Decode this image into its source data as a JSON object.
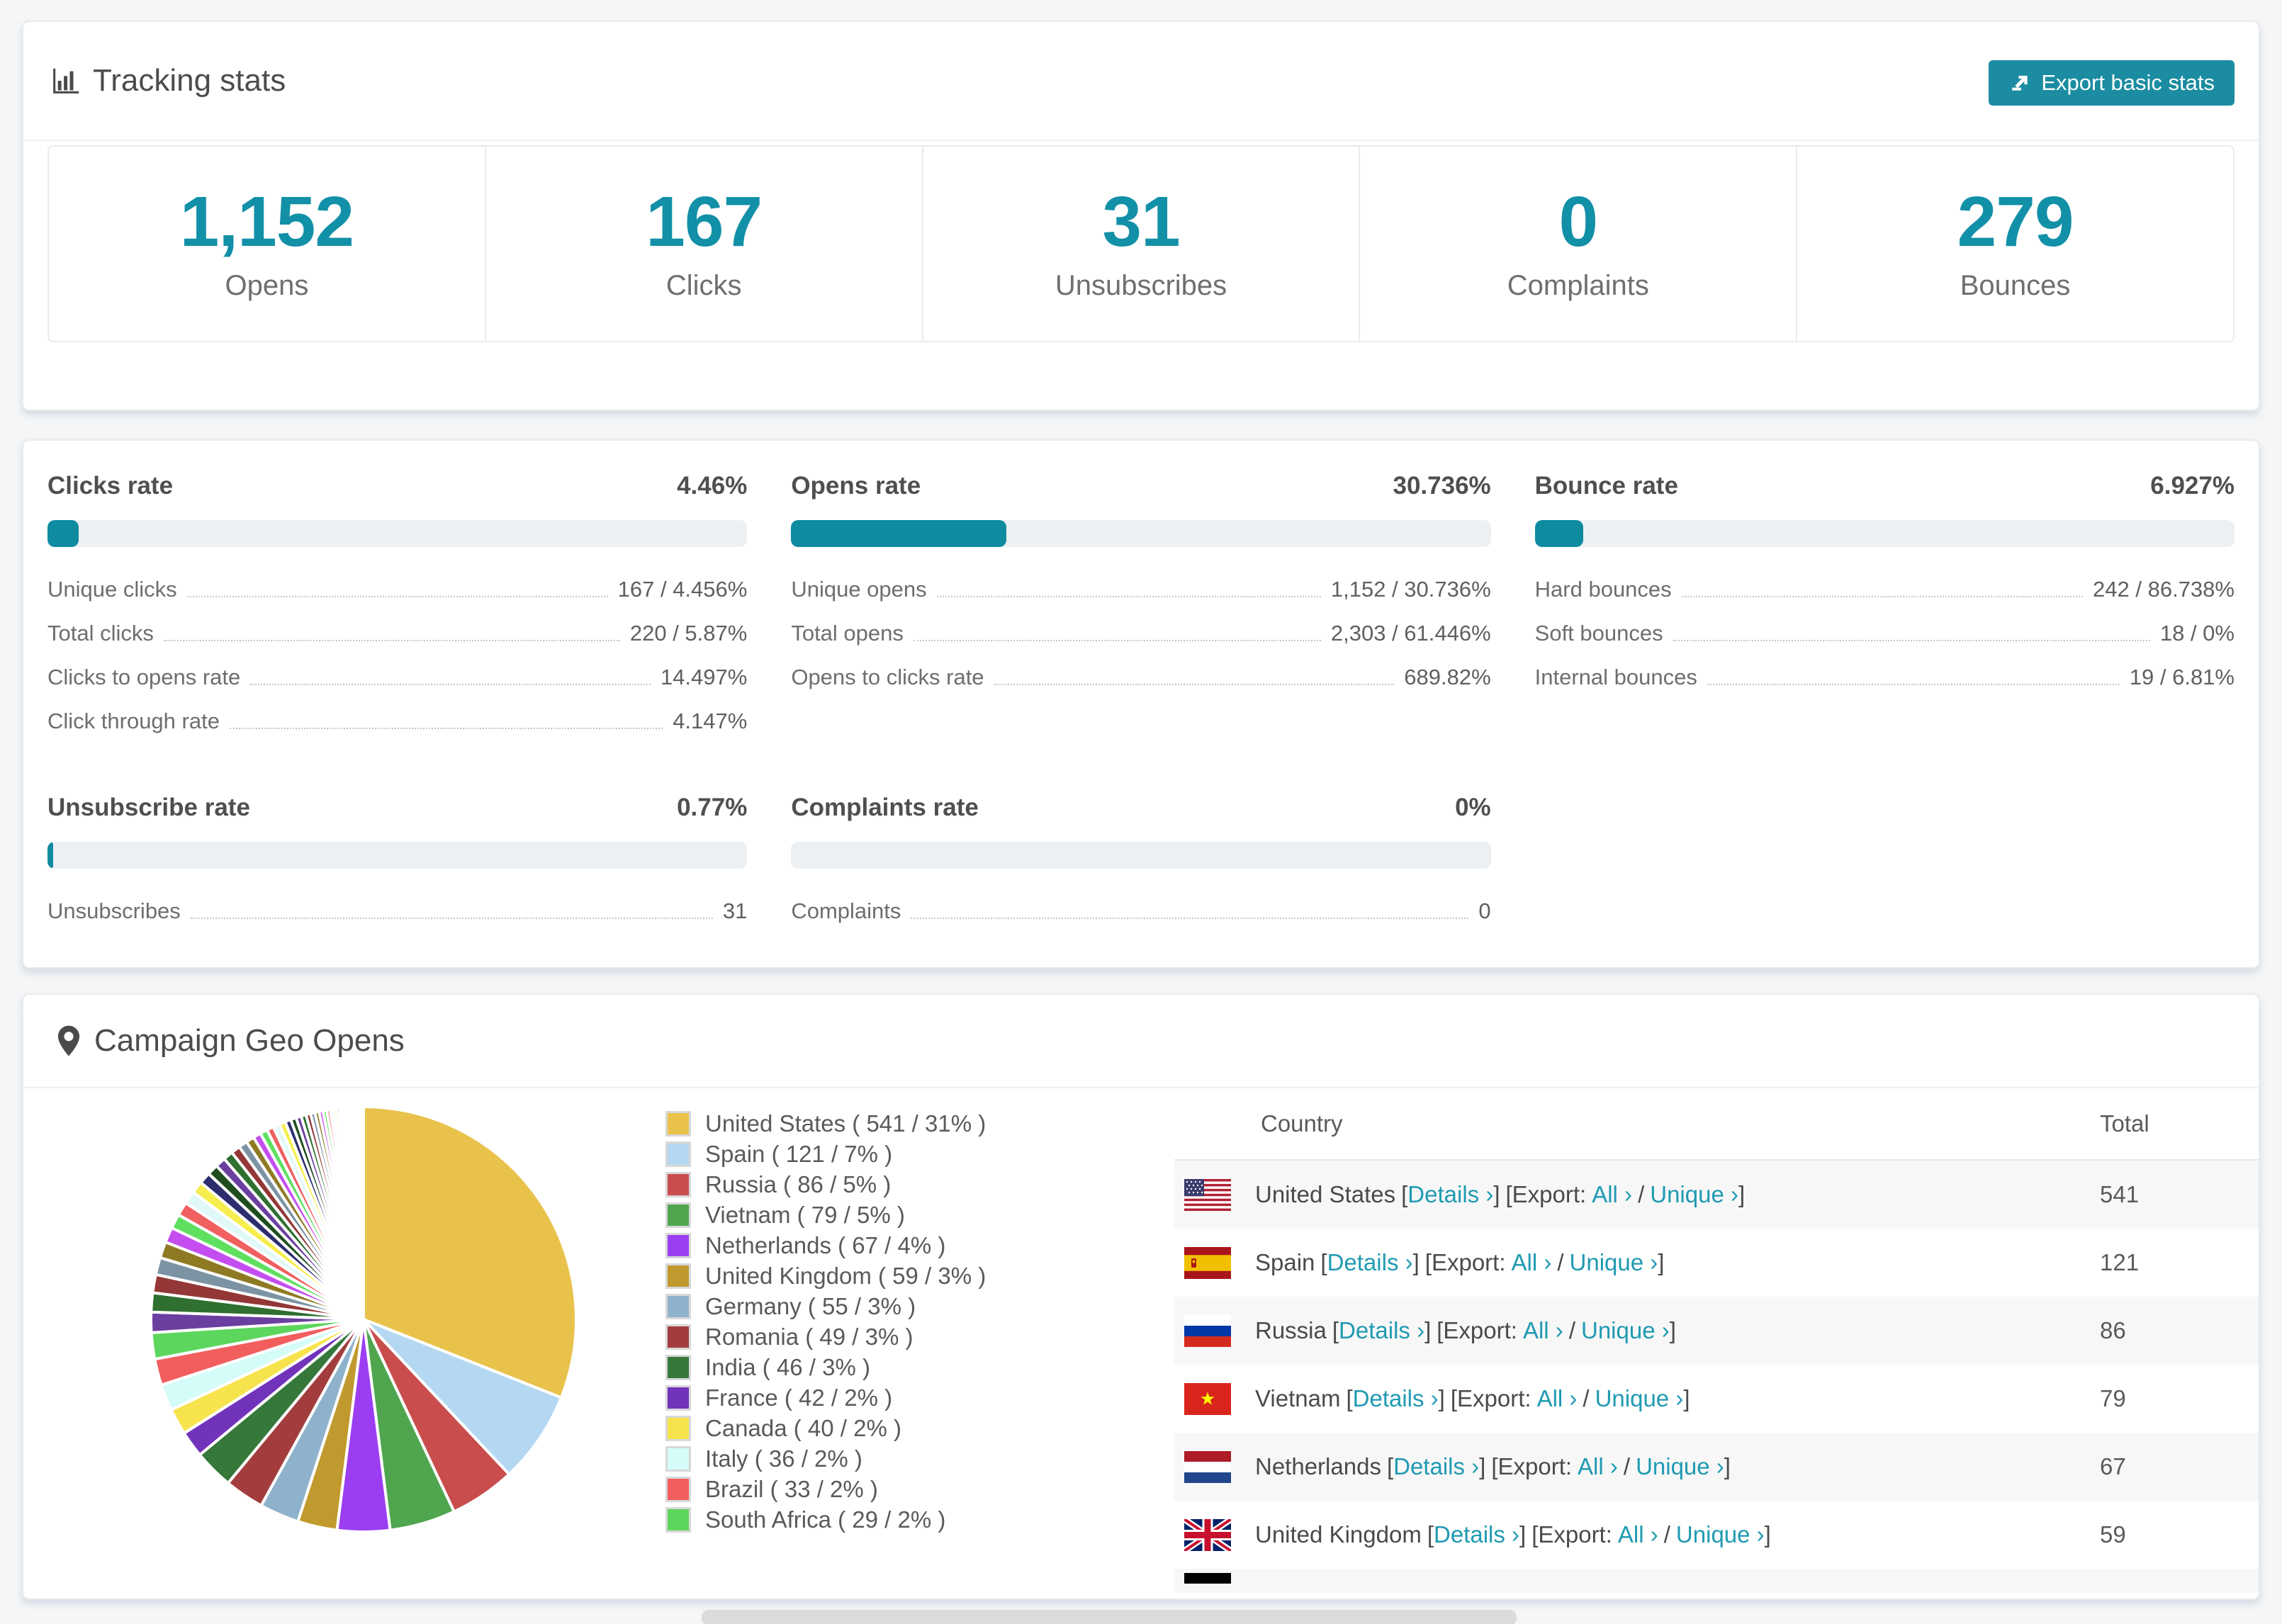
{
  "theme": {
    "accent": "#1290a7",
    "link_color": "#1f9ab2",
    "button_bg": "#1b8ca1",
    "bar_fill": "#0f8ba0",
    "bar_track": "#edf0f2"
  },
  "tracking": {
    "title": "Tracking stats",
    "export_label": "Export basic stats"
  },
  "summary": [
    {
      "value": "1,152",
      "label": "Opens"
    },
    {
      "value": "167",
      "label": "Clicks"
    },
    {
      "value": "31",
      "label": "Unsubscribes"
    },
    {
      "value": "0",
      "label": "Complaints"
    },
    {
      "value": "279",
      "label": "Bounces"
    }
  ],
  "rates": {
    "clicks": {
      "title": "Clicks rate",
      "value": "4.46%",
      "rows": [
        {
          "label": "Unique clicks",
          "value": "167 / 4.456%"
        },
        {
          "label": "Total clicks",
          "value": "220 / 5.87%"
        },
        {
          "label": "Clicks to opens rate",
          "value": "14.497%"
        },
        {
          "label": "Click through rate",
          "value": "4.147%"
        }
      ]
    },
    "opens": {
      "title": "Opens rate",
      "value": "30.736%",
      "rows": [
        {
          "label": "Unique opens",
          "value": "1,152 / 30.736%"
        },
        {
          "label": "Total opens",
          "value": "2,303 / 61.446%"
        },
        {
          "label": "Opens to clicks rate",
          "value": "689.82%"
        }
      ]
    },
    "bounce": {
      "title": "Bounce rate",
      "value": "6.927%",
      "rows": [
        {
          "label": "Hard bounces",
          "value": "242 / 86.738%"
        },
        {
          "label": "Soft bounces",
          "value": "18 / 0%"
        },
        {
          "label": "Internal bounces",
          "value": "19 / 6.81%"
        }
      ]
    },
    "unsubscribe": {
      "title": "Unsubscribe rate",
      "value": "0.77%",
      "rows": [
        {
          "label": "Unsubscribes",
          "value": "31"
        }
      ]
    },
    "complaints": {
      "title": "Complaints rate",
      "value": "0%",
      "rows": [
        {
          "label": "Complaints",
          "value": "0"
        }
      ]
    }
  },
  "geo": {
    "title": "Campaign Geo Opens",
    "legend": [
      {
        "label": "United States ( 541 / 31% )",
        "color": "#e8c24a"
      },
      {
        "label": "Spain ( 121 / 7% )",
        "color": "#b5d8f2"
      },
      {
        "label": "Russia ( 86 / 5% )",
        "color": "#c94d4d"
      },
      {
        "label": "Vietnam ( 79 / 5% )",
        "color": "#4fa64f"
      },
      {
        "label": "Netherlands ( 67 / 4% )",
        "color": "#9b3ef2"
      },
      {
        "label": "United Kingdom ( 59 / 3% )",
        "color": "#c09a2e"
      },
      {
        "label": "Germany ( 55 / 3% )",
        "color": "#8fb2cc"
      },
      {
        "label": "Romania ( 49 / 3% )",
        "color": "#a33d3d"
      },
      {
        "label": "India ( 46 / 3% )",
        "color": "#35783a"
      },
      {
        "label": "France ( 42 / 2% )",
        "color": "#7233bb"
      },
      {
        "label": "Canada ( 40 / 2% )",
        "color": "#f7e34d"
      },
      {
        "label": "Italy ( 36 / 2% )",
        "color": "#d4fcf9"
      },
      {
        "label": "Brazil ( 33 / 2% )",
        "color": "#f25e5e"
      },
      {
        "label": "South Africa ( 29 / 2% )",
        "color": "#5cd65c"
      }
    ],
    "table": {
      "columns": [
        "Country",
        "Total"
      ],
      "link_labels": {
        "open_bracket": "[",
        "close_bracket": "]",
        "details": "Details ›",
        "export_prefix": "[Export:",
        "all": "All ›",
        "slash": "/",
        "unique": "Unique ›"
      },
      "rows": [
        {
          "country": "United States",
          "total": "541",
          "flag": "us"
        },
        {
          "country": "Spain",
          "total": "121",
          "flag": "es"
        },
        {
          "country": "Russia",
          "total": "86",
          "flag": "ru"
        },
        {
          "country": "Vietnam",
          "total": "79",
          "flag": "vn"
        },
        {
          "country": "Netherlands",
          "total": "67",
          "flag": "nl"
        },
        {
          "country": "United Kingdom",
          "total": "59",
          "flag": "gb"
        }
      ],
      "partial_row": {
        "flag": "de"
      }
    }
  },
  "chart_data": {
    "type": "pie",
    "title": "Campaign Geo Opens",
    "unit": "opens",
    "legend_position": "right",
    "slices": [
      {
        "label": "United States",
        "value": 541,
        "percent": 31,
        "color": "#e8c24a"
      },
      {
        "label": "Spain",
        "value": 121,
        "percent": 7,
        "color": "#b5d8f2"
      },
      {
        "label": "Russia",
        "value": 86,
        "percent": 5,
        "color": "#c94d4d"
      },
      {
        "label": "Vietnam",
        "value": 79,
        "percent": 5,
        "color": "#4fa64f"
      },
      {
        "label": "Netherlands",
        "value": 67,
        "percent": 4,
        "color": "#9b3ef2"
      },
      {
        "label": "United Kingdom",
        "value": 59,
        "percent": 3,
        "color": "#c09a2e"
      },
      {
        "label": "Germany",
        "value": 55,
        "percent": 3,
        "color": "#8fb2cc"
      },
      {
        "label": "Romania",
        "value": 49,
        "percent": 3,
        "color": "#a33d3d"
      },
      {
        "label": "India",
        "value": 46,
        "percent": 3,
        "color": "#35783a"
      },
      {
        "label": "France",
        "value": 42,
        "percent": 2,
        "color": "#7233bb"
      },
      {
        "label": "Canada",
        "value": 40,
        "percent": 2,
        "color": "#f7e34d"
      },
      {
        "label": "Italy",
        "value": 36,
        "percent": 2,
        "color": "#d4fcf9"
      },
      {
        "label": "Brazil",
        "value": 33,
        "percent": 2,
        "color": "#f25e5e"
      },
      {
        "label": "South Africa",
        "value": 29,
        "percent": 2,
        "color": "#5cd65c"
      }
    ],
    "unlabeled_tail": {
      "total_percent": 26,
      "slice_count": 46,
      "palette": [
        "#6b3fa0",
        "#2f6f2f",
        "#943737",
        "#7b93a3",
        "#8f7a24",
        "#c44df0",
        "#5fe05f",
        "#f06060",
        "#e0f8f8",
        "#f5ee4e",
        "#2b2d6e",
        "#1f4d1f"
      ]
    }
  }
}
